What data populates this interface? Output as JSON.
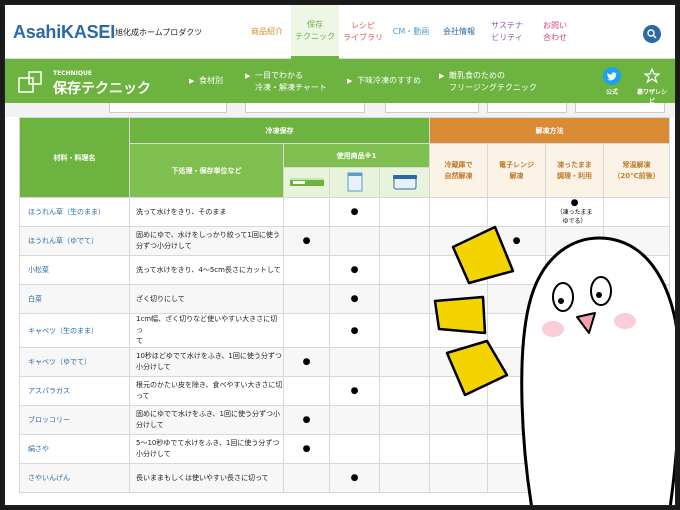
{
  "header": {
    "brand_main": "Asahi",
    "brand_bold": "KASEI",
    "brand_sub": "旭化成ホームプロダクツ",
    "nav": [
      {
        "label": "商品紹介",
        "color": "#d98b35"
      },
      {
        "label": "保存\nテクニック",
        "color": "#6cb33f"
      },
      {
        "label": "レシピ\nライブラリ",
        "color": "#e05a4e"
      },
      {
        "label": "CM・動画",
        "color": "#4aa3c8"
      },
      {
        "label": "会社情報",
        "color": "#2b6aa6"
      },
      {
        "label": "サステナ\nビリティ",
        "color": "#8a5bb0"
      },
      {
        "label": "お問い\n合わせ",
        "color": "#d6437d"
      }
    ],
    "search_icon": "search-icon"
  },
  "greenbar": {
    "eyebrow": "TECHNIQUE",
    "title": "保存テクニック",
    "links": [
      {
        "label": "食材別"
      },
      {
        "label": "一目でわかる\n冷凍・解凍チャート"
      },
      {
        "label": "下味冷凍のすすめ"
      },
      {
        "label": "離乳食のための\nフリージングテクニック"
      }
    ],
    "social": [
      {
        "label": "公式",
        "icon": "twitter-bird-icon"
      },
      {
        "label": "裏ワザレシピ",
        "icon": "recipe-icon"
      }
    ]
  },
  "table": {
    "col_name": "材料・料理名",
    "group_storage": "冷凍保存",
    "col_prep": "下処理・保存単位など",
    "group_products": "使用商品※1",
    "group_thaw": "解凍方法",
    "thaw_cols": [
      "冷蔵庫で\n自然解凍",
      "電子レンジ\n解凍",
      "凍ったまま\n調理・利用",
      "常温解凍\n（20℃前後）"
    ],
    "dot": "●",
    "rows": [
      {
        "name": "ほうれん草（生のまま）",
        "desc": "洗って水けをきり、そのまま",
        "p": [
          "",
          "●",
          ""
        ],
        "t": [
          "",
          "",
          "●",
          ""
        ],
        "note": "（凍ったまま\nゆでる）"
      },
      {
        "name": "ほうれん草（ゆでて）",
        "desc": "固めにゆで、水けをしっかり絞って1回に使う\n分ずつ小分けして",
        "p": [
          "●",
          "",
          ""
        ],
        "t": [
          "",
          "●",
          "",
          ""
        ],
        "note": ""
      },
      {
        "name": "小松菜",
        "desc": "洗って水けをきり、4～5cm長さにカットして",
        "p": [
          "",
          "●",
          ""
        ],
        "t": [
          "",
          "",
          "",
          ""
        ],
        "note": ""
      },
      {
        "name": "白菜",
        "desc": "ざく切りにして",
        "p": [
          "",
          "●",
          ""
        ],
        "t": [
          "",
          "",
          "",
          ""
        ],
        "note": ""
      },
      {
        "name": "キャベツ（生のまま）",
        "desc": "1cm幅、ざく切りなど使いやすい大きさに切っ\nて",
        "p": [
          "",
          "●",
          ""
        ],
        "t": [
          "",
          "",
          "",
          ""
        ],
        "note": ""
      },
      {
        "name": "キャベツ（ゆでて）",
        "desc": "10秒ほどゆでて水けをふき、1回に使う分ずつ\n小分けして",
        "p": [
          "●",
          "",
          ""
        ],
        "t": [
          "",
          "",
          "",
          ""
        ],
        "note": ""
      },
      {
        "name": "アスパラガス",
        "desc": "根元のかたい皮を除き、食べやすい大きさに切\nって",
        "p": [
          "",
          "●",
          ""
        ],
        "t": [
          "",
          "",
          "",
          ""
        ],
        "note": ""
      },
      {
        "name": "ブロッコリー",
        "desc": "固めにゆでて水けをふき、1回に使う分ずつ小\n分けして",
        "p": [
          "●",
          "",
          ""
        ],
        "t": [
          "",
          "",
          "",
          ""
        ],
        "note": ""
      },
      {
        "name": "絹さや",
        "desc": "5～10秒ゆでて水けをふき、1回に使う分ずつ\n小分けして",
        "p": [
          "●",
          "",
          ""
        ],
        "t": [
          "",
          "",
          "",
          ""
        ],
        "note": ""
      },
      {
        "name": "さやいんげん",
        "desc": "長いままもしくは使いやすい長さに切って",
        "p": [
          "",
          "●",
          ""
        ],
        "t": [
          "",
          "",
          "",
          ""
        ],
        "note": ""
      }
    ]
  },
  "colors": {
    "green": "#6cb33f",
    "orange": "#d98b35",
    "blue": "#2b6aa6",
    "burst": "#f4d400"
  }
}
